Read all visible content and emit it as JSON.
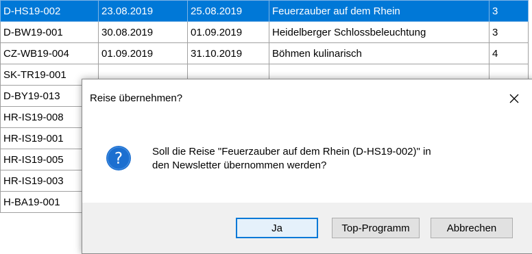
{
  "grid": {
    "rows": [
      {
        "code": "D-HS19-002",
        "start": "23.08.2019",
        "end": "25.08.2019",
        "title": "Feuerzauber auf dem Rhein",
        "count": "3"
      },
      {
        "code": "D-BW19-001",
        "start": "30.08.2019",
        "end": "01.09.2019",
        "title": "Heidelberger Schlossbeleuchtung",
        "count": "3"
      },
      {
        "code": "CZ-WB19-004",
        "start": "01.09.2019",
        "end": "31.10.2019",
        "title": "Böhmen kulinarisch",
        "count": "4"
      },
      {
        "code": "SK-TR19-001",
        "start": "",
        "end": "",
        "title": "",
        "count": ""
      },
      {
        "code": "D-BY19-013",
        "start": "",
        "end": "",
        "title": "",
        "count": ""
      },
      {
        "code": "HR-IS19-008",
        "start": "",
        "end": "",
        "title": "",
        "count": ""
      },
      {
        "code": "HR-IS19-001",
        "start": "",
        "end": "",
        "title": "",
        "count": ""
      },
      {
        "code": "HR-IS19-005",
        "start": "",
        "end": "",
        "title": "",
        "count": ""
      },
      {
        "code": "HR-IS19-003",
        "start": "",
        "end": "",
        "title": "",
        "count": ""
      },
      {
        "code": "H-BA19-001",
        "start": "",
        "end": "",
        "title": "",
        "count": ""
      }
    ],
    "selected_row": 0,
    "selection_color": "#0078d7"
  },
  "dialog": {
    "title": "Reise übernehmen?",
    "close_icon": "close-icon",
    "message_icon": "question-icon",
    "message_line1": "Soll die Reise \"Feuerzauber auf dem Rhein (D-HS19-002)\"  in",
    "message_line2": "den Newsletter übernommen werden?",
    "buttons": {
      "yes": "Ja",
      "top_program": "Top-Programm",
      "cancel": "Abbrechen"
    },
    "accent_color": "#0078d7",
    "icon_color": "#1c6fd0"
  }
}
